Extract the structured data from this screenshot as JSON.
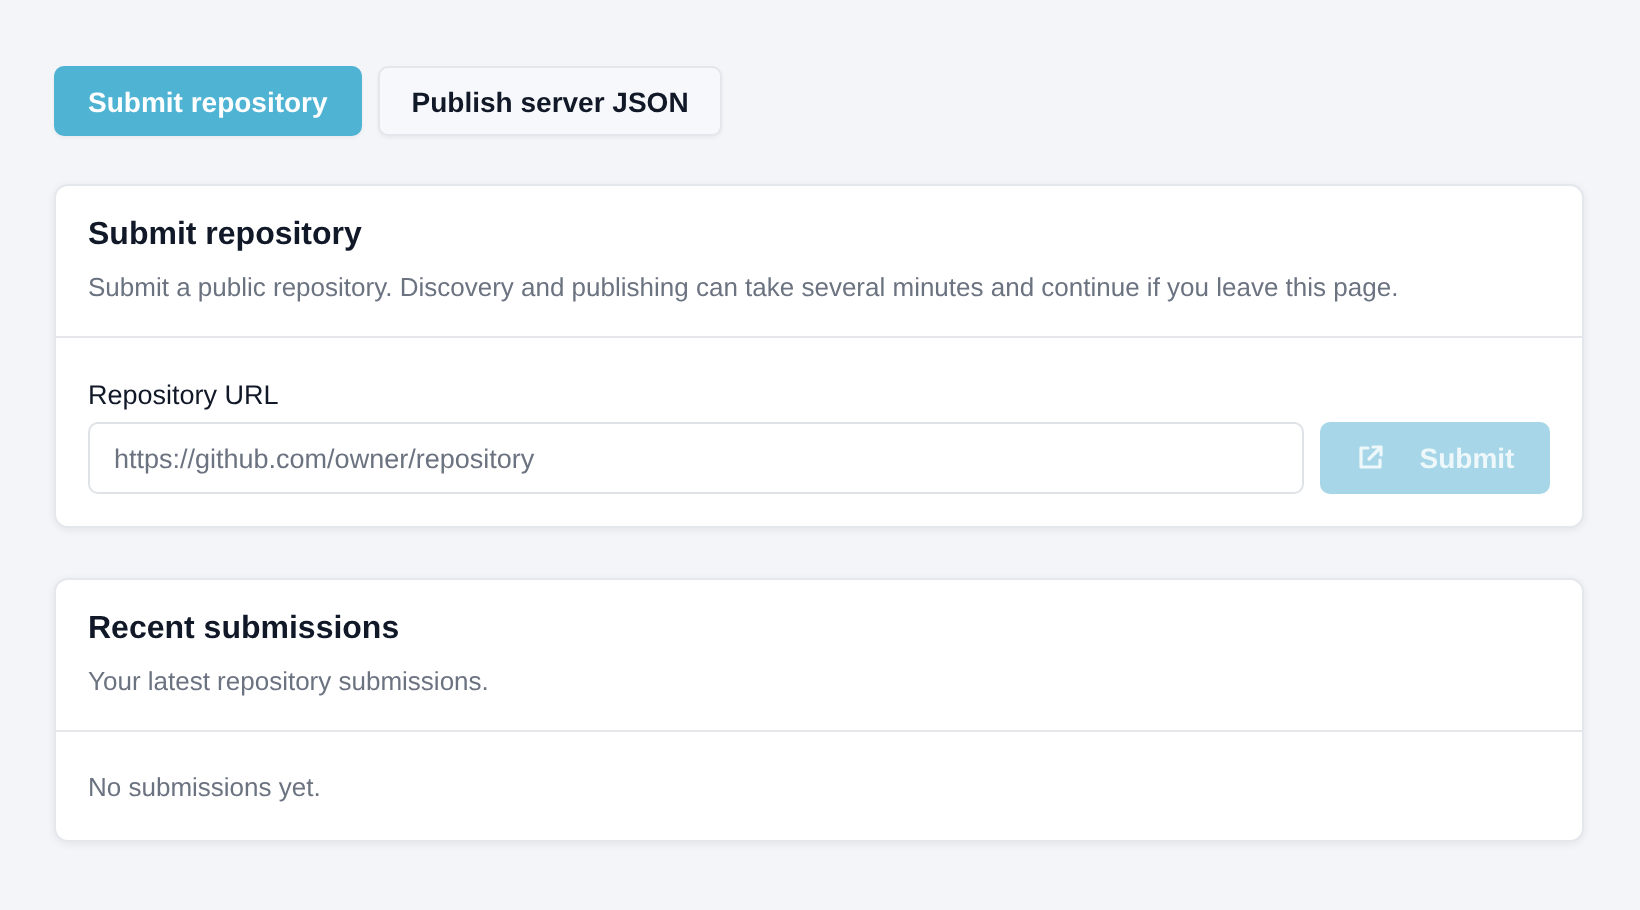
{
  "tabs": [
    {
      "label": "Submit repository",
      "selected": true
    },
    {
      "label": "Publish server JSON",
      "selected": false
    }
  ],
  "submit_card": {
    "title": "Submit repository",
    "description": "Submit a public repository. Discovery and publishing can take several minutes and continue if you leave this page.",
    "field_label": "Repository URL",
    "field": {
      "placeholder": "https://github.com/owner/repository"
    },
    "button": {
      "label": "Submit",
      "disabled": true
    }
  },
  "recent_card": {
    "title": "Recent submissions",
    "description": "Your latest repository submissions.",
    "empty_text": "No submissions yet."
  }
}
